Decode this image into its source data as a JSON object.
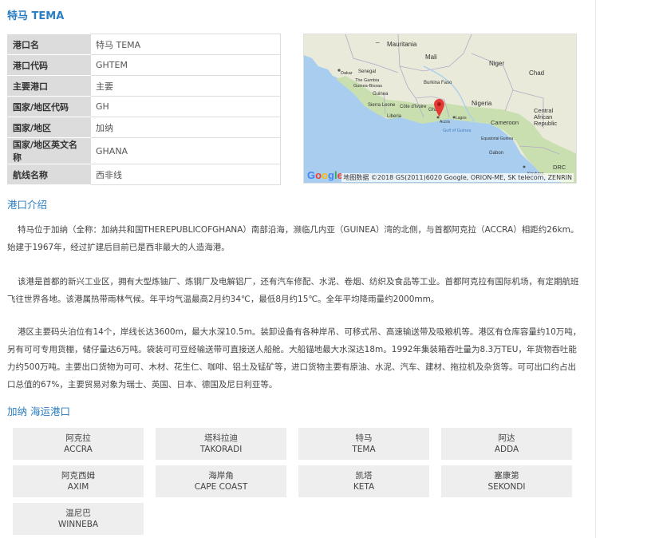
{
  "page_title": "特马 TEMA",
  "info_rows": [
    {
      "key": "港口名",
      "value": "特马 TEMA"
    },
    {
      "key": "港口代码",
      "value": "GHTEM"
    },
    {
      "key": "主要港口",
      "value": "主要"
    },
    {
      "key": "国家/地区代码",
      "value": "GH"
    },
    {
      "key": "国家/地区",
      "value": "加纳"
    },
    {
      "key": "国家/地区英文名称",
      "value": "GHANA"
    },
    {
      "key": "航线名称",
      "value": "西非线"
    }
  ],
  "map": {
    "labels": {
      "mauritania": "Mauritania",
      "mali": "Mali",
      "niger": "Niger",
      "chad": "Chad",
      "senegal": "Senegal",
      "dakar": "Dakar",
      "gambia": "The Gambia",
      "guinea_bissau": "Guinea-Bissau",
      "guinea": "Guinea",
      "sierra_leone": "Sierra Leone",
      "liberia": "Liberia",
      "cote_divoire": "Côte d'Ivoire",
      "burkina": "Burkina Faso",
      "ghana": "Gha",
      "nigeria": "Nigeria",
      "lagos": "Lagos",
      "accra": "Accra",
      "gulf": "Gulf of Guinea",
      "cameroon": "Cameroon",
      "car": "Central African Republic",
      "eq_guinea": "Equatorial Guinea",
      "gabon": "Gabon",
      "drc": "DRC",
      "kinshasa": "Kinshasa"
    },
    "google": "Google",
    "credit": "地图数据 ©2018 GS(2011)6020 Google, ORION-ME, SK telecom, ZENRIN",
    "colors": {
      "water": "#a9cdef",
      "land": "#e9ead9",
      "green": "#c9dfb0",
      "pin": "#e53935"
    }
  },
  "intro_title": "港口介绍",
  "paragraphs": [
    "特马位于加纳（全称：加纳共和国THEREPUBLICOFGHANA）南部沿海，濒临几内亚（GUINEA）湾的北侧，与首都阿克拉（ACCRA）相距约26km。始建于1967年，经过扩建后目前已是西非最大的人造海港。",
    "该港是首都的新兴工业区，拥有大型炼铀厂、炼钢厂及电解铝厂，还有汽车修配、水泥、卷烟、纺织及食品等工业。首都阿克拉有国际机场，有定期航班飞往世界各地。该港属热带雨林气候。年平均气温最高2月约34℃，最低8月约15℃。全年平均降雨量约2000mm。",
    "港区主要码头泊位有14个，岸线长达3600m，最大水深10.5m。装卸设备有各种岸吊、可移式吊、高速输送带及吸粮机等。港区有仓库容量约10万吨，另有可可专用货棚，储仔量达6万吨。袋装可可豆经输送带可直接送人船舱。大船锚地最大水深达18m。1992年集装箱吞吐量为8.3万TEU，年货物吞吐能力约500万吨。主要出口货物为可可、木材、花生仁、咖啡、铝土及锰矿等，进口货物主要有原油、水泥、汽车、建材、拖拉机及杂货等。可可出口约占出口总值的67%，主要贸易对象为瑞士、英国、日本、德国及尼日利亚等。"
  ],
  "ports_title": "加纳 海运港口",
  "ports": [
    {
      "cn": "阿克拉",
      "en": "ACCRA"
    },
    {
      "cn": "塔科拉迪",
      "en": "TAKORADI"
    },
    {
      "cn": "特马",
      "en": "TEMA"
    },
    {
      "cn": "阿达",
      "en": "ADDA"
    },
    {
      "cn": "阿克西姆",
      "en": "AXIM"
    },
    {
      "cn": "海岸角",
      "en": "CAPE COAST"
    },
    {
      "cn": "凯塔",
      "en": "KETA"
    },
    {
      "cn": "塞康第",
      "en": "SEKONDI"
    },
    {
      "cn": "温尼巴",
      "en": "WINNEBA"
    }
  ]
}
